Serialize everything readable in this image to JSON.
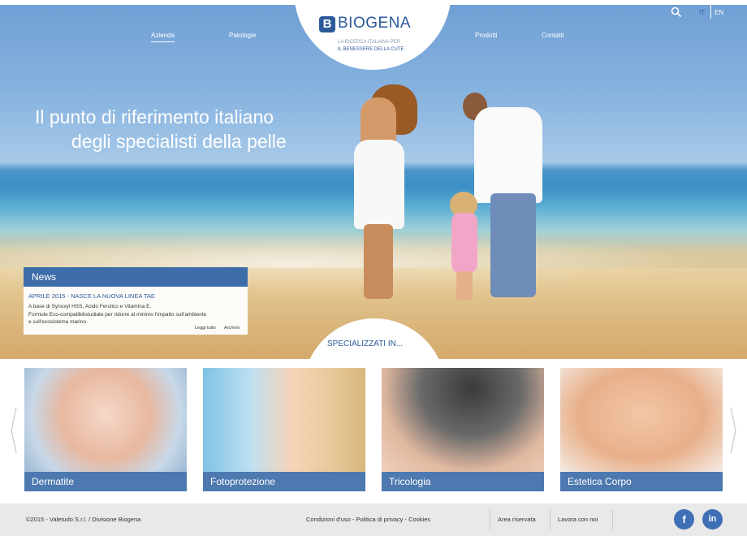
{
  "header": {
    "nav_left": [
      "Azienda",
      "Patologie"
    ],
    "nav_right": [
      "Prodotti",
      "Contatti"
    ],
    "logo": {
      "name": "BIOGENA",
      "tagline_line1": "LA RICERCA ITALIANA PER",
      "tagline_line2": "IL BENESSERE DELLA CUTE"
    },
    "languages": [
      "IT",
      "EN"
    ],
    "active_language": "IT",
    "search_icon": "search-icon"
  },
  "hero": {
    "headline_line1": "Il punto di riferimento italiano",
    "headline_line2": "degli specialisti della pelle"
  },
  "news": {
    "title": "News",
    "item_title": "APRILE 2015 - NASCE LA NUOVA LINEA TAE",
    "item_body_line1": "A base di Synoxyl HSS, Acido Ferulico e Vitamina E.",
    "item_body_line2": "Formule Eco-compatibilistudiate per ridurre al minimo l'impatto sull'ambiente",
    "item_body_line3": "e sull'ecosistema marino.",
    "read_all": "Leggi tutto",
    "archive": "Archivio"
  },
  "specialties": {
    "heading": "SPECIALIZZATI IN...",
    "items": [
      "Dermatite",
      "Fotoprotezione",
      "Tricologia",
      "Estetica Corpo"
    ]
  },
  "footer": {
    "copyright": "©2015 - Valetudo S.r.l. / Divisione Biogena",
    "legal_links": "Condizioni d'uso - Politica di privacy - Cookies",
    "reserved_area": "Area riservata",
    "work_with_us": "Lavora con noi",
    "social": [
      "f",
      "in"
    ]
  },
  "colors": {
    "brand_blue": "#2b5a9a",
    "bar_blue": "#3e6ea9",
    "social_blue": "#3f6fb5"
  }
}
